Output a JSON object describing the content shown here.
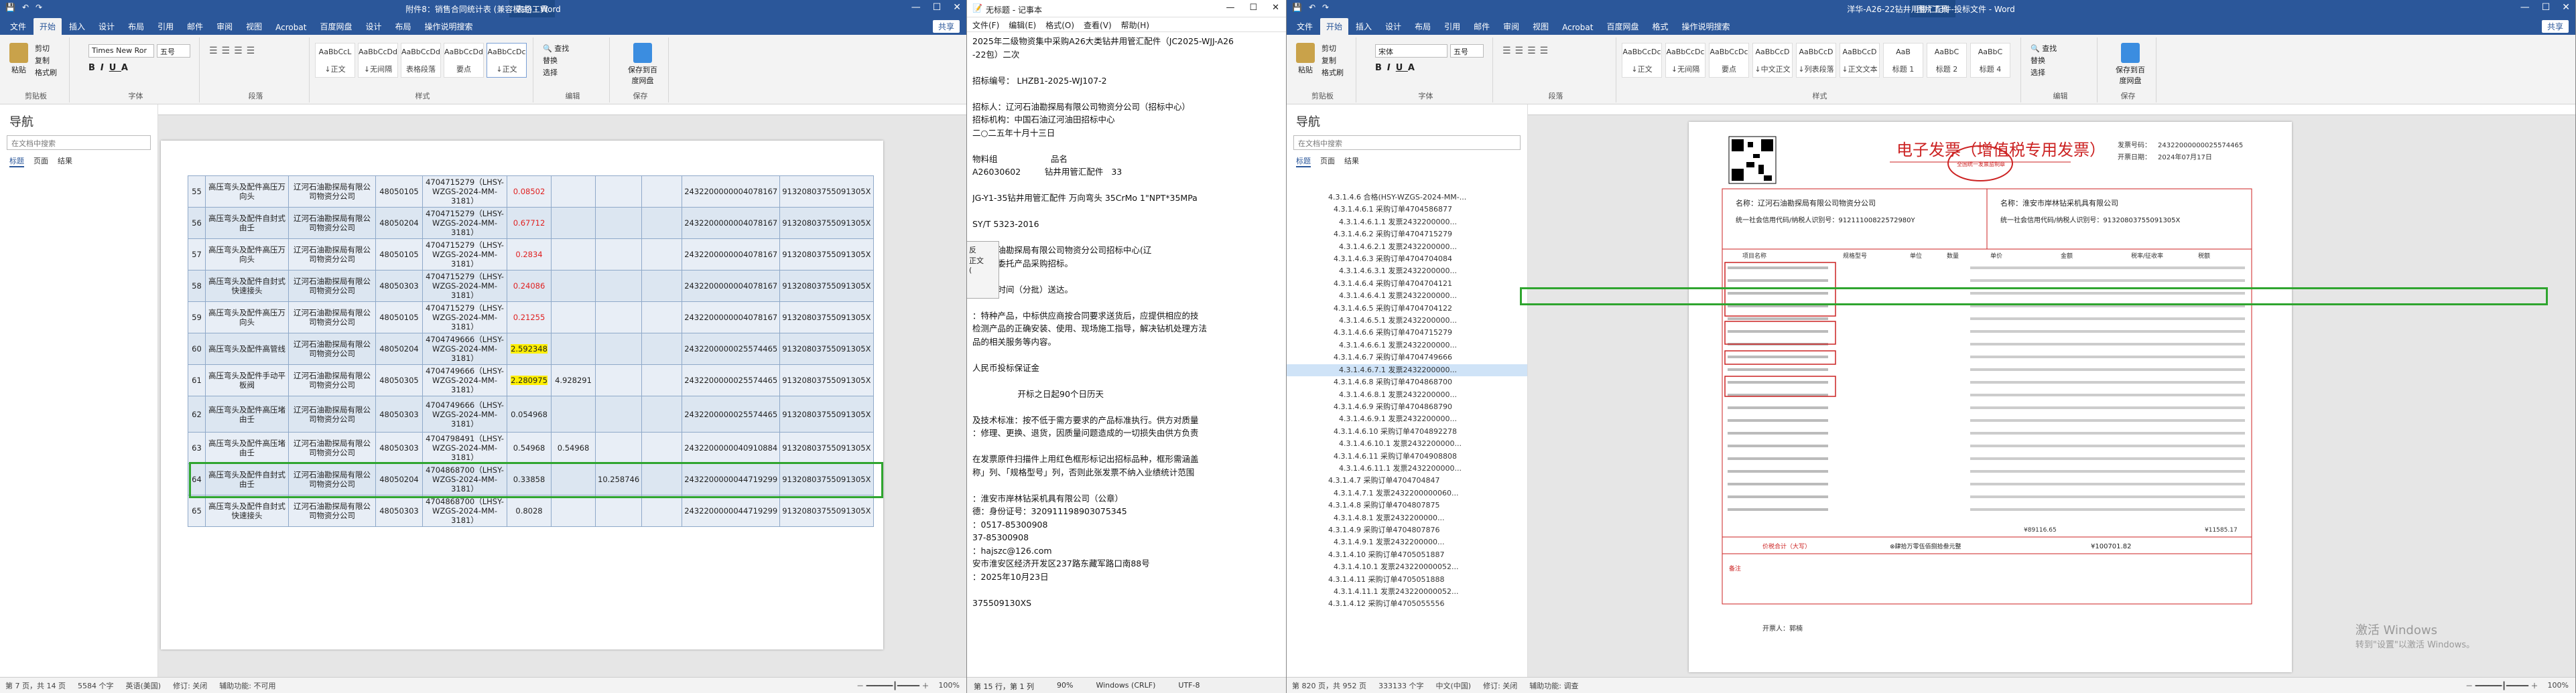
{
  "w1": {
    "title": "附件8：销售合同统计表 (兼容模式) - Word",
    "context_tab": "表格工具",
    "tabs": [
      "文件",
      "开始",
      "插入",
      "设计",
      "布局",
      "引用",
      "邮件",
      "审阅",
      "视图",
      "Acrobat",
      "百度网盘",
      "设计",
      "布局",
      "操作说明搜索"
    ],
    "share": "共享",
    "clipboard": {
      "paste": "粘贴",
      "cut": "剪切",
      "copy": "复制",
      "format": "格式刷",
      "label": "剪贴板"
    },
    "font": {
      "name": "Times New Ror",
      "size": "五号",
      "label": "字体"
    },
    "paragraph_label": "段落",
    "styles": [
      {
        "preview": "AaBbCcL",
        "name": "↓正文"
      },
      {
        "preview": "AaBbCcDd",
        "name": "↓无间隔"
      },
      {
        "preview": "AaBbCcDd",
        "name": "表格段落"
      },
      {
        "preview": "AaBbCcDd",
        "name": "要点"
      },
      {
        "preview": "AaBbCcDc",
        "name": "↓正文"
      }
    ],
    "styles_label": "样式",
    "edit": {
      "find": "查找",
      "replace": "替换",
      "select": "选择",
      "label": "编辑"
    },
    "baidu": "保存到百度网盘",
    "baidu_label": "保存",
    "nav": {
      "title": "导航",
      "search": "在文档中搜索",
      "tabs": [
        "标题",
        "页面",
        "结果"
      ]
    },
    "rows": [
      {
        "no": "55",
        "name": "高压弯头及配件高压万向头",
        "buyer": "辽河石油勘探局有限公司物资分公司",
        "code": "48050105",
        "contract": "4704715279（LHSY-WZGS-2024-MM-3181）",
        "price": "0.08502",
        "amount": "",
        "pay": "",
        "sign": "",
        "tax": "2432200000004078167",
        "credit": "91320803755091305X"
      },
      {
        "no": "56",
        "name": "高压弯头及配件自封式由壬",
        "buyer": "辽河石油勘探局有限公司物资分公司",
        "code": "48050204",
        "contract": "4704715279（LHSY-WZGS-2024-MM-3181）",
        "price": "0.67712",
        "amount": "",
        "pay": "",
        "sign": "",
        "tax": "2432200000004078167",
        "credit": "91320803755091305X"
      },
      {
        "no": "57",
        "name": "高压弯头及配件高压万向头",
        "buyer": "辽河石油勘探局有限公司物资分公司",
        "code": "48050105",
        "contract": "4704715279（LHSY-WZGS-2024-MM-3181）",
        "price": "0.2834",
        "amount": "",
        "pay": "",
        "sign": "",
        "tax": "2432200000004078167",
        "credit": "91320803755091305X"
      },
      {
        "no": "58",
        "name": "高压弯头及配件自封式快速接头",
        "buyer": "辽河石油勘探局有限公司物资分公司",
        "code": "48050303",
        "contract": "4704715279（LHSY-WZGS-2024-MM-3181）",
        "price": "0.24086",
        "amount": "",
        "pay": "",
        "sign": "",
        "tax": "2432200000004078167",
        "credit": "91320803755091305X"
      },
      {
        "no": "59",
        "name": "高压弯头及配件高压万向头",
        "buyer": "辽河石油勘探局有限公司物资分公司",
        "code": "48050105",
        "contract": "4704715279（LHSY-WZGS-2024-MM-3181）",
        "price": "0.21255",
        "amount": "",
        "pay": "",
        "sign": "",
        "tax": "2432200000004078167",
        "credit": "91320803755091305X"
      },
      {
        "no": "60",
        "name": "高压弯头及配件高管线",
        "buyer": "辽河石油勘探局有限公司物资分公司",
        "code": "48050204",
        "contract": "4704749666（LHSY-WZGS-2024-MM-3181）",
        "price": "2.592348",
        "amount": "",
        "pay": "",
        "sign": "",
        "tax": "2432200000025574465",
        "credit": "91320803755091305X"
      },
      {
        "no": "61",
        "name": "高压弯头及配件手动平板阀",
        "buyer": "辽河石油勘探局有限公司物资分公司",
        "code": "48050305",
        "contract": "4704749666（LHSY-WZGS-2024-MM-3181）",
        "price": "2.280975",
        "amount": "4.928291",
        "pay": "",
        "sign": "",
        "tax": "2432200000025574465",
        "credit": "91320803755091305X"
      },
      {
        "no": "62",
        "name": "高压弯头及配件高压堵由壬",
        "buyer": "辽河石油勘探局有限公司物资分公司",
        "code": "48050303",
        "contract": "4704749666（LHSY-WZGS-2024-MM-3181）",
        "price": "0.054968",
        "amount": "",
        "pay": "",
        "sign": "",
        "tax": "2432200000025574465",
        "credit": "91320803755091305X"
      },
      {
        "no": "63",
        "name": "高压弯头及配件高压堵由壬",
        "buyer": "辽河石油勘探局有限公司物资分公司",
        "code": "48050303",
        "contract": "4704798491（LHSY-WZGS-2024-MM-3181）",
        "price": "0.54968",
        "amount": "0.54968",
        "pay": "",
        "sign": "",
        "tax": "2432200000040910884",
        "credit": "91320803755091305X"
      },
      {
        "no": "64",
        "name": "高压弯头及配件自封式由壬",
        "buyer": "辽河石油勘探局有限公司物资分公司",
        "code": "48050204",
        "contract": "4704868700（LHSY-WZGS-2024-MM-3181）",
        "price": "0.33858",
        "amount": "",
        "pay": "10.258746",
        "sign": "",
        "tax": "2432200000044719299",
        "credit": "91320803755091305X"
      },
      {
        "no": "65",
        "name": "高压弯头及配件自封式快速接头",
        "buyer": "辽河石油勘探局有限公司物资分公司",
        "code": "48050303",
        "contract": "4704868700（LHSY-WZGS-2024-MM-3181）",
        "price": "0.8028",
        "amount": "",
        "pay": "",
        "sign": "",
        "tax": "2432200000044719299",
        "credit": "91320803755091305X"
      }
    ],
    "status": {
      "page": "第 7 页，共 14 页",
      "words": "5584 个字",
      "lang": "英语(美国)",
      "track": "修订: 关闭",
      "access": "辅助功能: 不可用",
      "zoom": "100%"
    }
  },
  "np": {
    "title": "无标题 - 记事本",
    "menu": [
      "文件(F)",
      "编辑(E)",
      "格式(O)",
      "查看(V)",
      "帮助(H)"
    ],
    "lines": [
      "2025年二级物资集中采购A26大类钻井用管汇配件（JC2025-WJJ-A26",
      "-22包）二次",
      "",
      "招标编号： LHZB1-2025-WJ107-2",
      "",
      "招标人：辽河石油勘探局有限公司物资分公司（招标中心）",
      "招标机构：中国石油辽河油田招标中心",
      "二○二五年十月十三日",
      "",
      "物料组                    品名",
      "A26030602         钻井用管汇配件   33",
      "",
      "JG-Y1-35钻井用管汇配件 万向弯头 35CrMo 1\"NPT*35MPa",
      "",
      "SY/T 5323-2016",
      "",
      "辽河石油勘探局有限公司物资分公司招标中心(辽",
      "公司）委托产品采购招标。",
      "",
      "采购定时间（分批）送达。",
      "",
      "：特种产品，中标供应商按合同要求送货后，应提供相应的技",
      "检测产品的正确安装、使用、现场施工指导，解决钻机处理方法",
      "品的相关服务等内容。",
      "",
      "人民币投标保证金",
      "",
      "                 开标之日起90个日历天",
      "",
      "及技术标准：按不低于需方要求的产品标准执行。供方对质量",
      "：修理、更换、退货，因质量问题造成的一切损失由供方负责",
      "",
      "在发票原件扫描件上用红色框形标记出招标品种，框形需涵盖",
      "称」列、「规格型号」列，否则此张发票不纳入业绩统计范围",
      "",
      "：淮安市岸林钻采机具有限公司（公章）",
      "德：身份证号：320911198903075345",
      "：0517-85300908",
      "37-85300908",
      "：hajszc@126.com",
      "安市淮安区经济开发区237路东藏军路口南88号",
      "：2025年10月23日",
      "",
      "375509130XS"
    ],
    "find": [
      "反",
      "正文",
      "("
    ],
    "status": {
      "pos": "第 15 行，第 1 列",
      "zoom": "90%",
      "eol": "Windows (CRLF)",
      "enc": "UTF-8"
    }
  },
  "w2": {
    "title": "洋华-A26-22钻井用管汇配件-投标文件 - Word",
    "context_tab": "图片工具",
    "tabs": [
      "文件",
      "开始",
      "插入",
      "设计",
      "布局",
      "引用",
      "邮件",
      "审阅",
      "视图",
      "Acrobat",
      "百度网盘",
      "格式",
      "操作说明搜索"
    ],
    "share": "共享",
    "styles": [
      {
        "preview": "AaBbCcDc",
        "name": "↓正文"
      },
      {
        "preview": "AaBbCcDc",
        "name": "↓无间隔"
      },
      {
        "preview": "AaBbCcDc",
        "name": "要点"
      },
      {
        "preview": "AaBbCcD",
        "name": "↓中文正文"
      },
      {
        "preview": "AaBbCcD",
        "name": "↓列表段落"
      },
      {
        "preview": "AaBbCcD",
        "name": "↓正文文本"
      },
      {
        "preview": "AaB",
        "name": "标题 1"
      },
      {
        "preview": "AaBbC",
        "name": "标题 2"
      },
      {
        "preview": "AaBbC",
        "name": "标题 4"
      }
    ],
    "font": {
      "name": "宋体",
      "size": "五号"
    },
    "nav": {
      "title": "导航",
      "search": "在文档中搜索",
      "tabs": [
        "标题",
        "页面",
        "结果"
      ]
    },
    "tree": [
      "4.3.1.4.6 合格(HSY-WZGS-2024-MM-...",
      "4.3.1.4.6.1 采购订单4704586877",
      "4.3.1.4.6.1.1 发票2432200000...",
      "4.3.1.4.6.2 采购订单4704715279",
      "4.3.1.4.6.2.1 发票2432200000...",
      "4.3.1.4.6.3 采购订单4704704084",
      "4.3.1.4.6.3.1 发票2432200000...",
      "4.3.1.4.6.4 采购订单4704704121",
      "4.3.1.4.6.4.1 发票2432200000...",
      "4.3.1.4.6.5 采购订单4704704122",
      "4.3.1.4.6.5.1 发票2432200000...",
      "4.3.1.4.6.6 采购订单4704715279",
      "4.3.1.4.6.6.1 发票2432200000...",
      "4.3.1.4.6.7 采购订单4704749666",
      "4.3.1.4.6.7.1 发票2432200000...",
      "4.3.1.4.6.8 采购订单4704868700",
      "4.3.1.4.6.8.1 发票2432200000...",
      "4.3.1.4.6.9 采购订单4704868790",
      "4.3.1.4.6.9.1 发票2432200000...",
      "4.3.1.4.6.10 采购订单4704892278",
      "4.3.1.4.6.10.1 发票2432200000...",
      "4.3.1.4.6.11 采购订单4704908808",
      "4.3.1.4.6.11.1 发票2432200000...",
      "4.3.1.4.7 采购订单4704704847",
      "4.3.1.4.7.1 发票2432200000060...",
      "4.3.1.4.8 采购订单4704807875",
      "4.3.1.4.8.1 发票2432200000...",
      "4.3.1.4.9 采购订单4704807876",
      "4.3.1.4.9.1 发票2432200000...",
      "4.3.1.4.10 采购订单4705051887",
      "4.3.1.4.10.1 发票243220000052...",
      "4.3.1.4.11 采购订单4705051888",
      "4.3.1.4.11.1 发票243220000052...",
      "4.3.1.4.12 采购订单4705055556"
    ],
    "tree_sel": 14,
    "invoice": {
      "title": "电子发票（增值税专用发票）",
      "seal": "全国统一发票监制章",
      "no_label": "发票号码：",
      "no": "24322000000025574465",
      "date_label": "开票日期：",
      "date": "2024年07月17日",
      "buyer_name": "名称：辽河石油勘探局有限公司物资分公司",
      "buyer_id": "统一社会信用代码/纳税人识别号：91211100822572980Y",
      "seller_name": "名称：淮安市岸林钻采机具有限公司",
      "seller_id": "统一社会信用代码/纳税人识别号：91320803755091305X",
      "headers": [
        "项目名称",
        "规格型号",
        "单位",
        "数量",
        "单价",
        "金额",
        "税率/征收率",
        "税额"
      ],
      "total_label": "价税合计（大写）",
      "total_cn": "⊗肆拾万零伍佰捌拾叁元整",
      "total": "¥100701.82",
      "remarks_label": "备注",
      "issuer": "开票人：郭楠",
      "subtotal_amt": "¥89116.65",
      "subtotal_tax": "¥11585.17"
    },
    "activate": {
      "line1": "激活 Windows",
      "line2": "转到\"设置\"以激活 Windows。"
    },
    "status": {
      "page": "第 820 页，共 952 页",
      "words": "333133 个字",
      "lang": "中文(中国)",
      "track": "修订: 关闭",
      "access": "辅助功能: 调查",
      "zoom": "100%"
    }
  }
}
